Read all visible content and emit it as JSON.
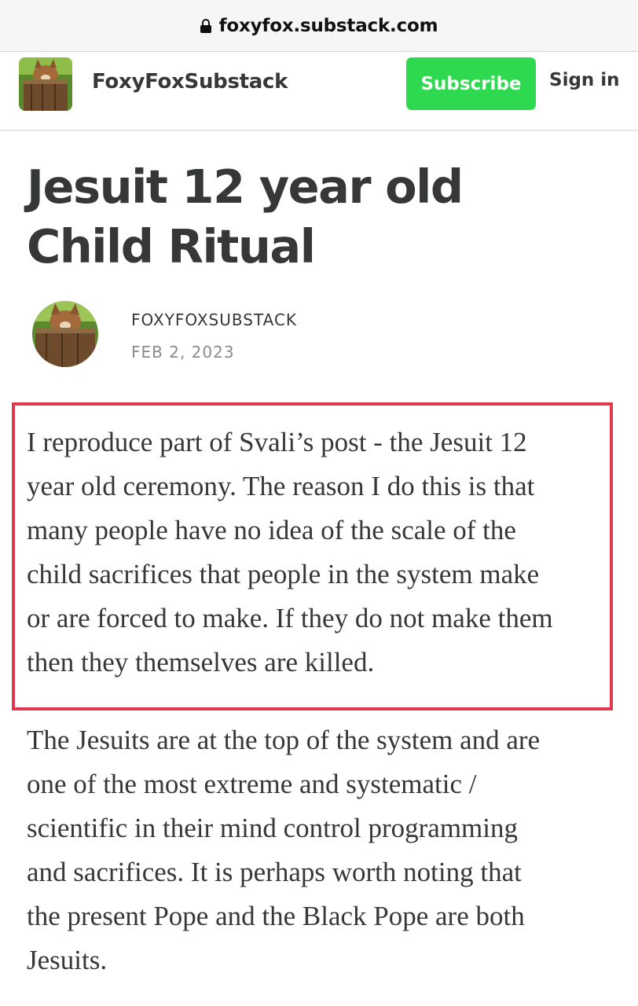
{
  "browser": {
    "url": "foxyfox.substack.com",
    "lock_icon": "lock-icon"
  },
  "header": {
    "publication_name": "FoxyFoxSubstack",
    "subscribe_label": "Subscribe",
    "signin_label": "Sign in",
    "accent_color": "#2fd94f"
  },
  "post": {
    "title_lines": [
      "Jesuit 12 year old",
      "Child Ritual"
    ],
    "author": "FOXYFOXSUBSTACK",
    "date": "FEB 2, 2023",
    "highlight_color": "#e3364f",
    "paragraph1_lines": [
      "I reproduce part of Svali’s post - the Jesuit 12",
      "year old ceremony. The reason I do this is that",
      "many people have no idea of the scale of the",
      "child sacrifices that people in the system make",
      "or are forced to make. If they do not make them",
      "then they themselves are killed."
    ],
    "paragraph2_lines": [
      "The Jesuits are at the top of the system and are",
      "one of the most extreme and systematic /",
      "scientific in their mind control programming",
      "and sacrifices. It is perhaps worth noting that",
      "the present Pope and the Black Pope are both",
      "Jesuits."
    ]
  }
}
